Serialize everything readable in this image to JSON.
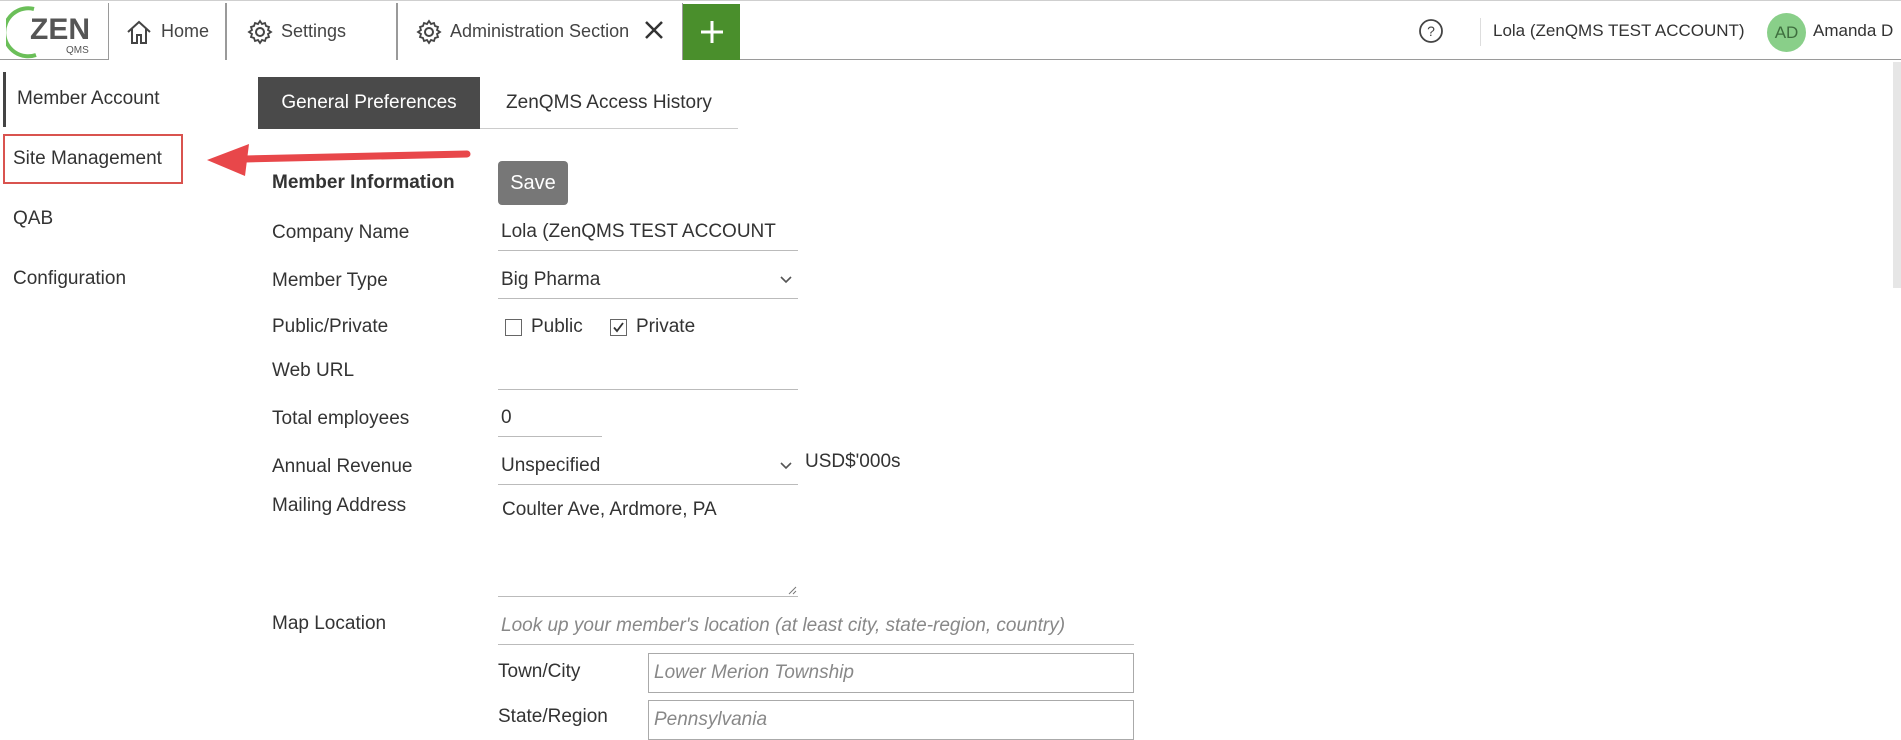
{
  "logo": {
    "text": "ZEN",
    "subtext": "QMS"
  },
  "tabs": [
    {
      "label": "Home",
      "icon": "home-icon"
    },
    {
      "label": "Settings",
      "icon": "gear-icon",
      "closable": true
    },
    {
      "label": "Administration Section",
      "icon": "gear-icon",
      "closable": true
    }
  ],
  "header": {
    "account": "Lola (ZenQMS TEST ACCOUNT)",
    "avatar_initials": "AD",
    "user_name": "Amanda D"
  },
  "sidebar": {
    "items": [
      {
        "label": "Member Account"
      },
      {
        "label": "Site Management"
      },
      {
        "label": "QAB"
      },
      {
        "label": "Configuration"
      }
    ]
  },
  "content_tabs": [
    {
      "label": "General Preferences"
    },
    {
      "label": "ZenQMS Access History"
    }
  ],
  "form": {
    "section_title": "Member Information",
    "save_label": "Save",
    "company_name_label": "Company Name",
    "company_name_value": "Lola (ZenQMS TEST ACCOUNT",
    "member_type_label": "Member Type",
    "member_type_value": "Big Pharma",
    "public_private_label": "Public/Private",
    "public_label": "Public",
    "private_label": "Private",
    "web_url_label": "Web URL",
    "web_url_value": "",
    "total_employees_label": "Total employees",
    "total_employees_value": "0",
    "annual_revenue_label": "Annual Revenue",
    "annual_revenue_value": "Unspecified",
    "annual_revenue_suffix": "USD$'000s",
    "mailing_address_label": "Mailing Address",
    "mailing_address_value": "Coulter Ave, Ardmore, PA",
    "map_location_label": "Map Location",
    "map_location_placeholder": "Look up your member's location (at least city, state-region, country)",
    "town_label": "Town/City",
    "town_placeholder": "Lower Merion Township",
    "state_label": "State/Region",
    "state_placeholder": "Pennsylvania"
  },
  "colors": {
    "accent_green": "#4a8f2c",
    "tab_active_bg": "#4a4a4a",
    "highlight_red": "#d9534f",
    "avatar_bg": "#89cf89"
  }
}
